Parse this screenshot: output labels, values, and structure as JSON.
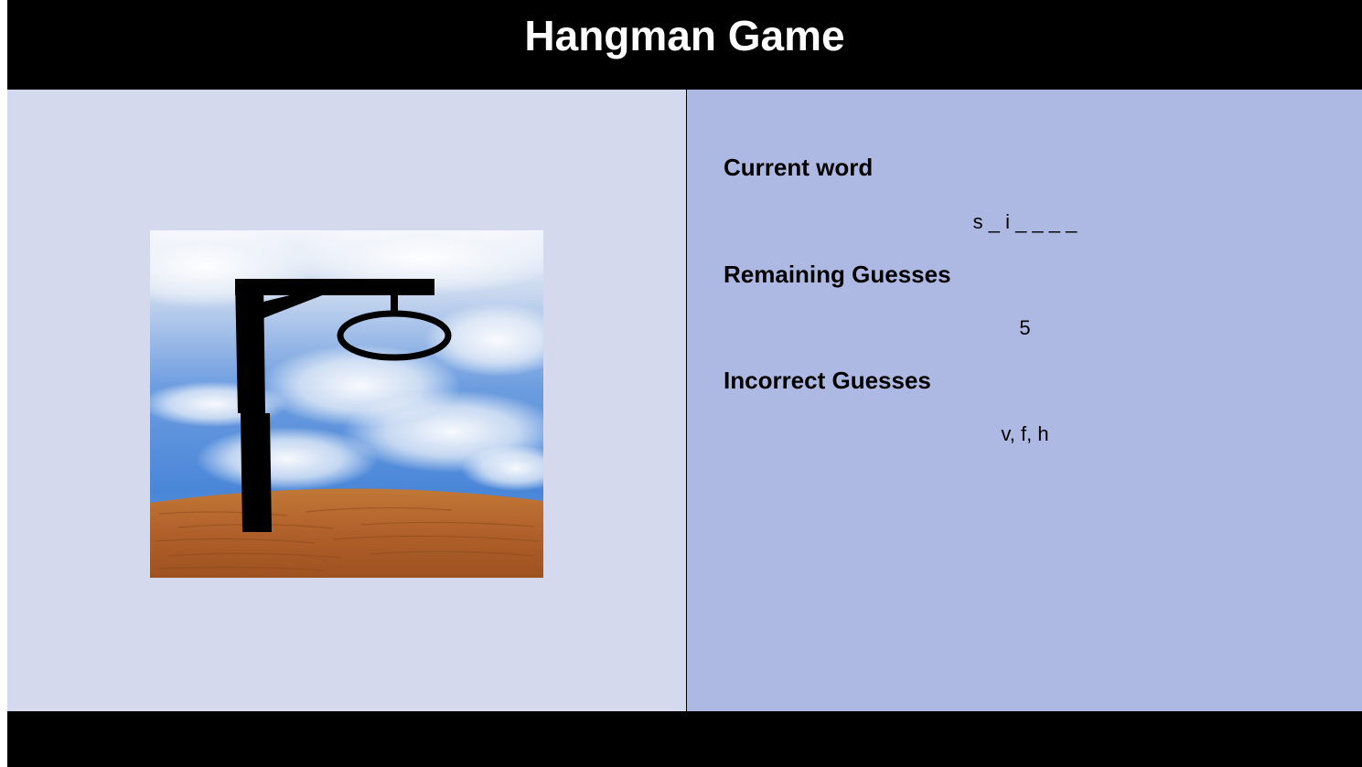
{
  "header": {
    "title": "Hangman Game"
  },
  "game": {
    "current_word_heading": "Current word",
    "current_word": "s _ i _ _ _ _",
    "remaining_guesses_heading": "Remaining Guesses",
    "remaining_guesses": "5",
    "incorrect_guesses_heading": "Incorrect Guesses",
    "incorrect_guesses": "v, f, h"
  },
  "colors": {
    "header_bg": "#000000",
    "left_panel_bg": "#d4d9ee",
    "right_panel_bg": "#aeb9e3",
    "footer_bg": "#000000",
    "sky_top": "#f2f5fa",
    "sky_bottom": "#4d86d6",
    "ground": "#b8652a"
  },
  "image": {
    "icon": "gallows-icon"
  }
}
